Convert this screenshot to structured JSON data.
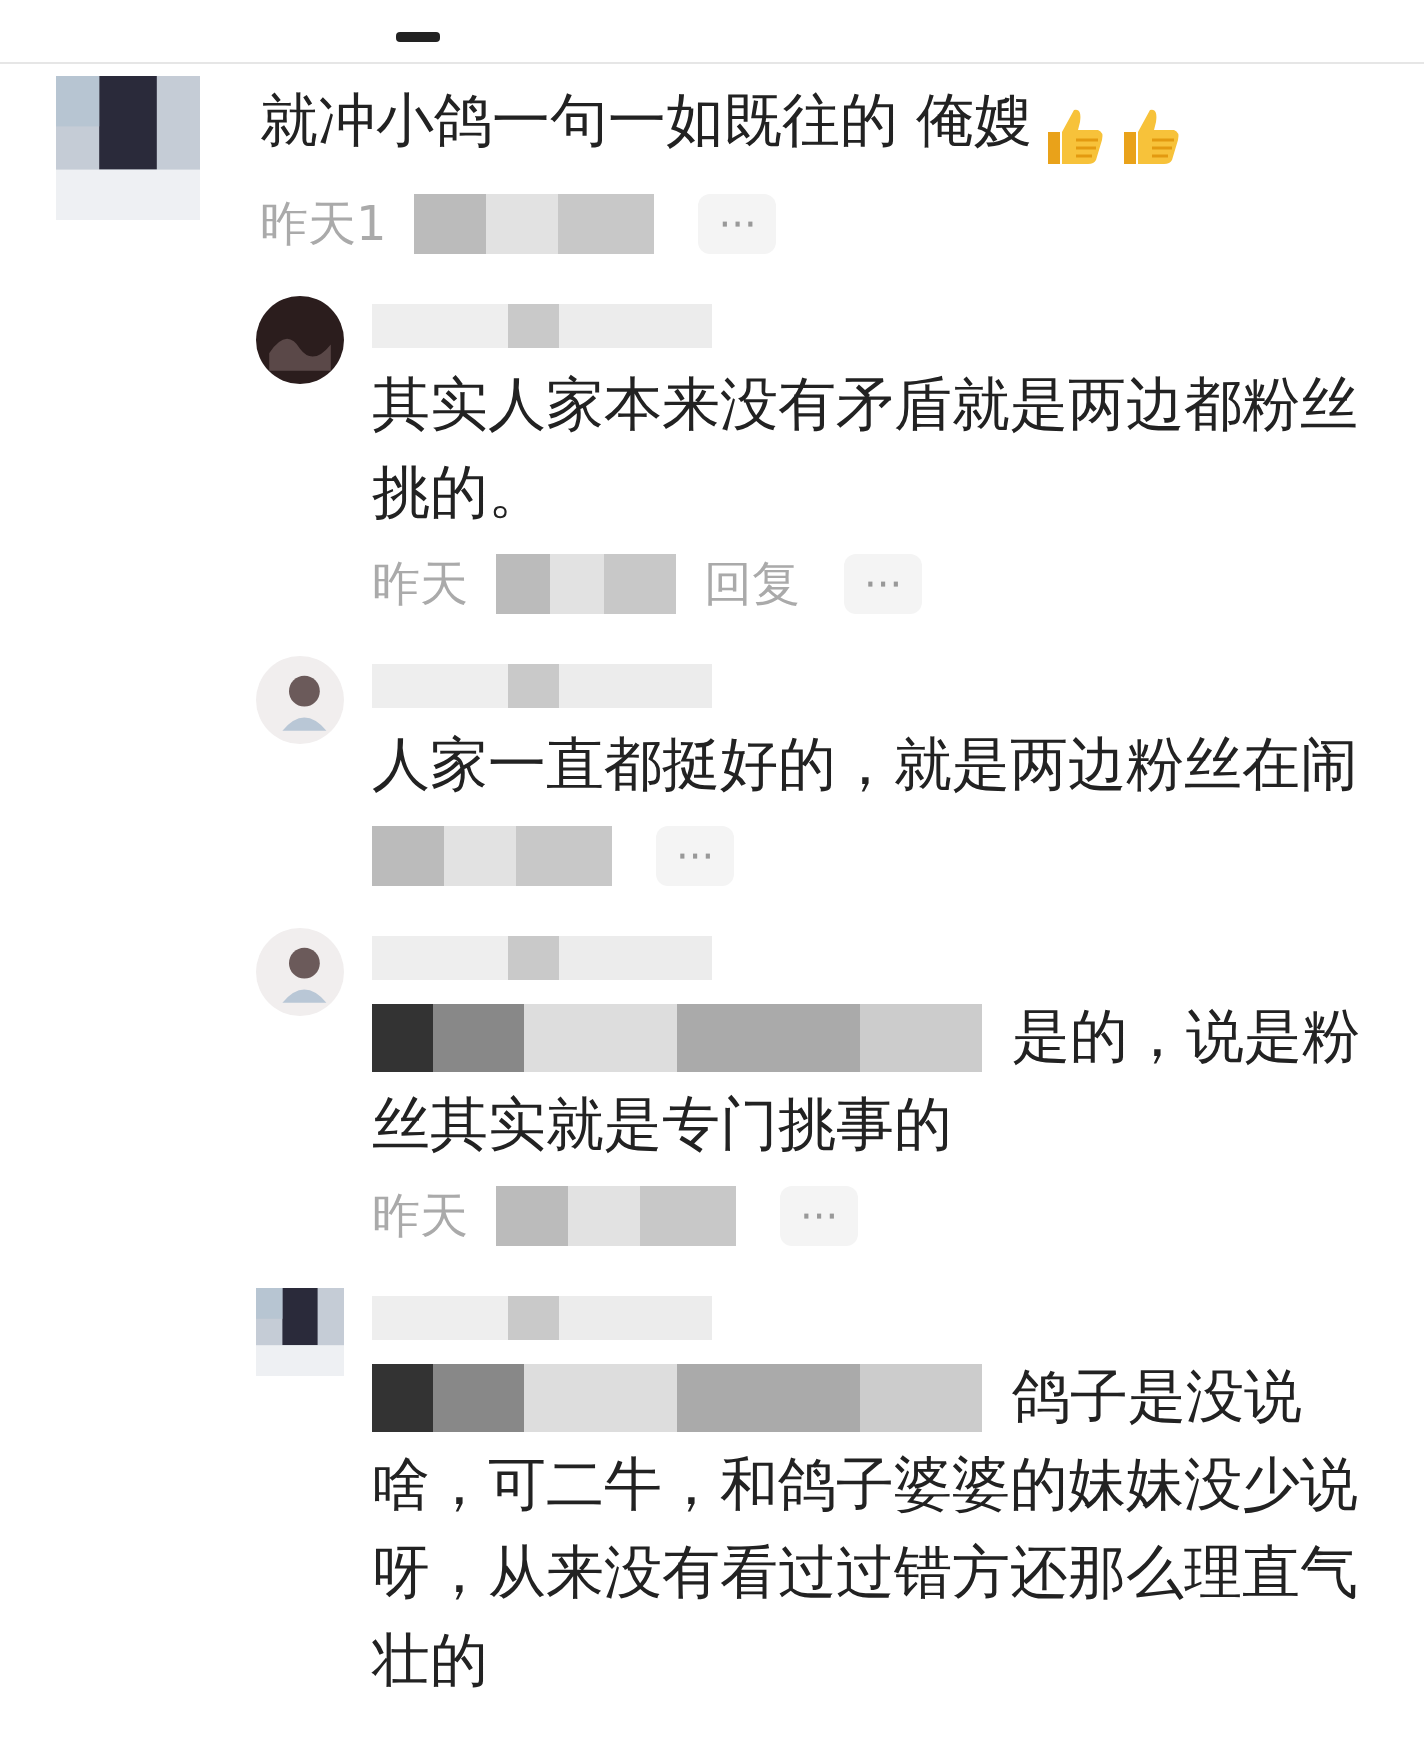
{
  "comments": [
    {
      "kind": "top",
      "avatar": {
        "kind": "square"
      },
      "text": "就冲小鸽一句一如既往的 俺嫂",
      "thumbs_icons": true,
      "time": "昨天1",
      "meta_blurred": true,
      "more": "···"
    },
    {
      "kind": "reply",
      "avatar": {
        "kind": "dark"
      },
      "name_blurred": true,
      "text": "其实人家本来没有矛盾就是两边都粉丝挑的。",
      "time": "昨天",
      "meta_blurred": true,
      "reply": "回复",
      "more": "···"
    },
    {
      "kind": "reply",
      "avatar": {
        "kind": "light"
      },
      "name_blurred": true,
      "text": "人家一直都挺好的，就是两边粉丝在闹",
      "meta_blurred": true,
      "more": "···"
    },
    {
      "kind": "reply",
      "avatar": {
        "kind": "light"
      },
      "name_blurred": true,
      "prefix_blurred": true,
      "text": "是的，说是粉丝其实就是专门挑事的",
      "time": "昨天",
      "meta_blurred": true,
      "more": "···"
    },
    {
      "kind": "reply",
      "avatar": {
        "kind": "square"
      },
      "name_blurred": true,
      "prefix_blurred": true,
      "text": "鸽子是没说啥，可二牛，和鸽子婆婆的妹妹没少说呀，从来没有看过过错方还那么理直气壮的"
    }
  ]
}
